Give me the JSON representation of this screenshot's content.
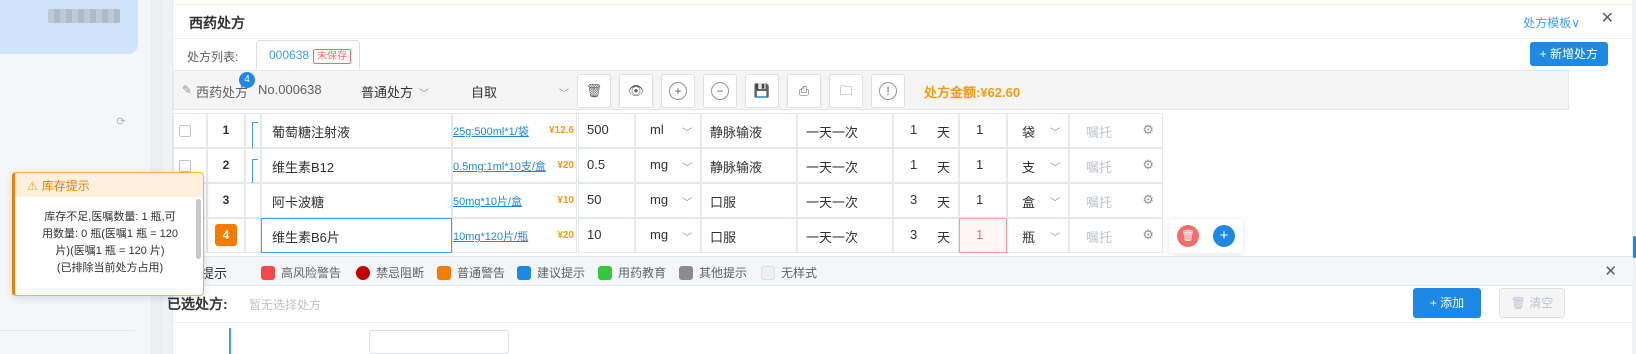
{
  "panel": {
    "title": "西药处方",
    "template_link": "处方模板∨",
    "close_glyph": "✕"
  },
  "rx_list": {
    "label": "处方列表:",
    "tab_no": "000638",
    "tab_status": "未保存",
    "new_button": "+ 新增处方"
  },
  "toolbar": {
    "title": "西药处方",
    "badge": "4",
    "rx_no": "No.000638",
    "rx_type": "普通处方",
    "pickup": "自取",
    "amount": "处方金额:¥62.60",
    "icons": [
      "delete-icon",
      "eye-icon",
      "plus-icon",
      "minus-icon",
      "save-icon",
      "print-icon",
      "folder-icon",
      "info-icon"
    ]
  },
  "drugs": [
    {
      "index": "1",
      "name": "葡萄糖注射液",
      "spec": "25g:500ml*1/袋",
      "price": "¥12.6",
      "dose": "500",
      "dose_unit": "ml",
      "route": "静脉输液",
      "freq": "一天一次",
      "days": "1",
      "days_unit": "天",
      "qty": "1",
      "qty_unit": "袋",
      "note_placeholder": "嘱托"
    },
    {
      "index": "2",
      "name": "维生素B12",
      "spec": "0.5mg:1ml*10支/盒",
      "price": "¥20",
      "dose": "0.5",
      "dose_unit": "mg",
      "route": "静脉输液",
      "freq": "一天一次",
      "days": "1",
      "days_unit": "天",
      "qty": "1",
      "qty_unit": "支",
      "note_placeholder": "嘱托"
    },
    {
      "index": "3",
      "name": "阿卡波糖",
      "spec": "50mg*10片/盒",
      "price": "¥10",
      "dose": "50",
      "dose_unit": "mg",
      "route": "口服",
      "freq": "一天一次",
      "days": "3",
      "days_unit": "天",
      "qty": "1",
      "qty_unit": "盒",
      "note_placeholder": "嘱托"
    },
    {
      "index": "4",
      "name": "维生素B6片",
      "spec": "10mg*120片/瓶",
      "price": "¥20",
      "dose": "10",
      "dose_unit": "mg",
      "route": "口服",
      "freq": "一天一次",
      "days": "3",
      "days_unit": "天",
      "qty": "1",
      "qty_unit": "瓶",
      "note_placeholder": "嘱托"
    }
  ],
  "legend": {
    "title": "提示",
    "items": [
      {
        "label": "高风险警告",
        "color": "#f5484b"
      },
      {
        "label": "禁忌阻断",
        "color": "#c00000"
      },
      {
        "label": "普通警告",
        "color": "#f57c00"
      },
      {
        "label": "建议提示",
        "color": "#1e88e5"
      },
      {
        "label": "用药教育",
        "color": "#34c840"
      },
      {
        "label": "其他提示",
        "color": "#8c8c8c"
      },
      {
        "label": "无样式",
        "color": "#f0f0f0"
      }
    ]
  },
  "selected": {
    "label": "已选处方:",
    "empty": "暂无选择处方",
    "add_button": "+ 添加",
    "clear_button": "清空"
  },
  "tooltip": {
    "title": "库存提示",
    "line1": "库存不足,医嘱数量: 1 瓶,可",
    "line2": "用数量: 0 瓶(医嘱1 瓶 = 120",
    "line3": "片)(医嘱1 瓶 = 120 片)",
    "line4": "(已排除当前处方占用)"
  }
}
